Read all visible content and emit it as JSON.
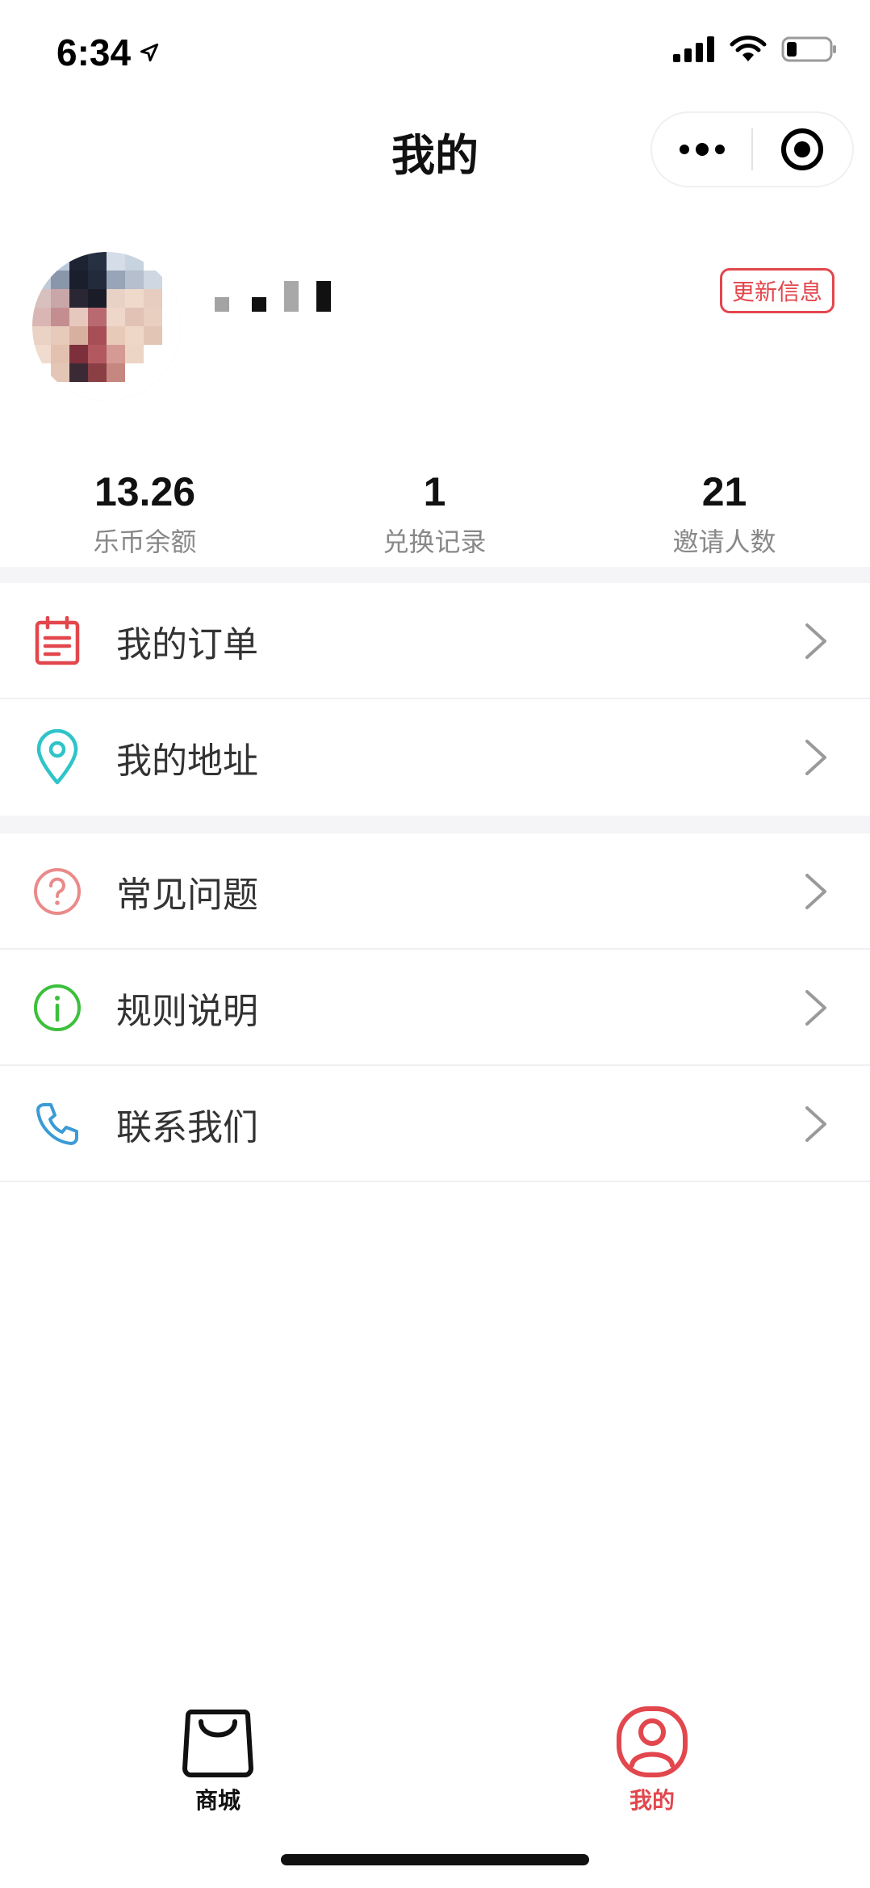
{
  "status_bar": {
    "time": "6:34",
    "icons": [
      "location-arrow-icon",
      "signal-icon",
      "wifi-icon",
      "battery-icon"
    ]
  },
  "nav": {
    "title": "我的",
    "capsule_icons": [
      "more-icon",
      "close-miniprogram-icon"
    ]
  },
  "profile": {
    "update_label": "更新信息",
    "accent_color": "#e2474d"
  },
  "stats": [
    {
      "value": "13.26",
      "label": "乐币余额"
    },
    {
      "value": "1",
      "label": "兑换记录"
    },
    {
      "value": "21",
      "label": "邀请人数"
    }
  ],
  "menu_group_1": [
    {
      "label": "我的订单",
      "icon": "order-list-icon",
      "color": "#e2474d"
    },
    {
      "label": "我的地址",
      "icon": "location-pin-icon",
      "color": "#2ec4c9"
    }
  ],
  "menu_group_2": [
    {
      "label": "常见问题",
      "icon": "question-circle-icon",
      "color": "#ea8a8a"
    },
    {
      "label": "规则说明",
      "icon": "info-circle-icon",
      "color": "#3cc03c"
    },
    {
      "label": "联系我们",
      "icon": "phone-icon",
      "color": "#3b9bd6"
    }
  ],
  "tabbar": {
    "items": [
      {
        "label": "商城",
        "icon": "shopping-bag-icon",
        "color": "#111111"
      },
      {
        "label": "我的",
        "icon": "user-icon",
        "color": "#e2474d",
        "selected": true
      }
    ]
  }
}
